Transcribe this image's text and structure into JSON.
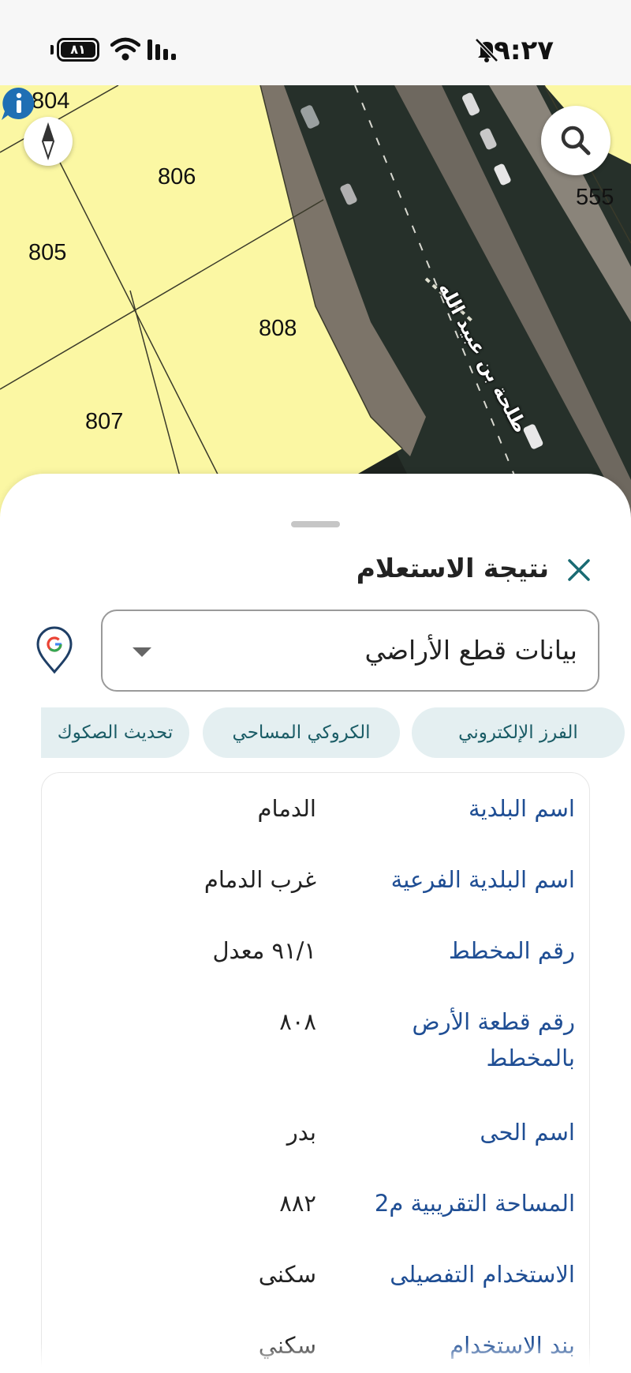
{
  "status_bar": {
    "battery": "٨١",
    "time": "٩:٢٧",
    "icons": [
      "battery-icon",
      "wifi-icon",
      "signal-icon",
      "bell-off-icon"
    ]
  },
  "map": {
    "parcels": [
      "804",
      "806",
      "805",
      "808",
      "807",
      "555"
    ],
    "street_name": "طلحة بن عبيد الله",
    "colors": {
      "parcel_fill": "#fbf7a3",
      "road": "#1e2420",
      "sidewalk": "#7c7469"
    },
    "controls": {
      "compass": "compass-icon",
      "search": "search-icon",
      "info": "info-icon"
    }
  },
  "sheet": {
    "title": "نتيجة الاستعلام",
    "close_icon": "close-icon",
    "dropdown": {
      "value": "بيانات قطع الأراضي",
      "icon": "chevron-down-icon"
    },
    "google_pin": "google-maps-pin-icon",
    "chips": [
      "الفرز الإلكتروني",
      "الكروكي المساحي",
      "تحديث الصكوك"
    ],
    "chip_colors": {
      "background": "#e4eff1",
      "text": "#1a5c66"
    },
    "info_rows": [
      {
        "label": "اسم البلدية",
        "value": "الدمام"
      },
      {
        "label": "اسم البلدية الفرعية",
        "value": "غرب الدمام"
      },
      {
        "label": "رقم المخطط",
        "value": "٩١/١ معدل"
      },
      {
        "label": "رقم قطعة الأرض بالمخطط",
        "value": "٨٠٨"
      },
      {
        "label": "اسم الحى",
        "value": "بدر"
      },
      {
        "label": "المساحة التقريبية م2",
        "value": "٨٨٢"
      },
      {
        "label": "الاستخدام التفصيلى",
        "value": "سكنى"
      },
      {
        "label": "بند الاستخدام",
        "value": "سكني"
      }
    ],
    "label_color": "#1f4e94"
  }
}
